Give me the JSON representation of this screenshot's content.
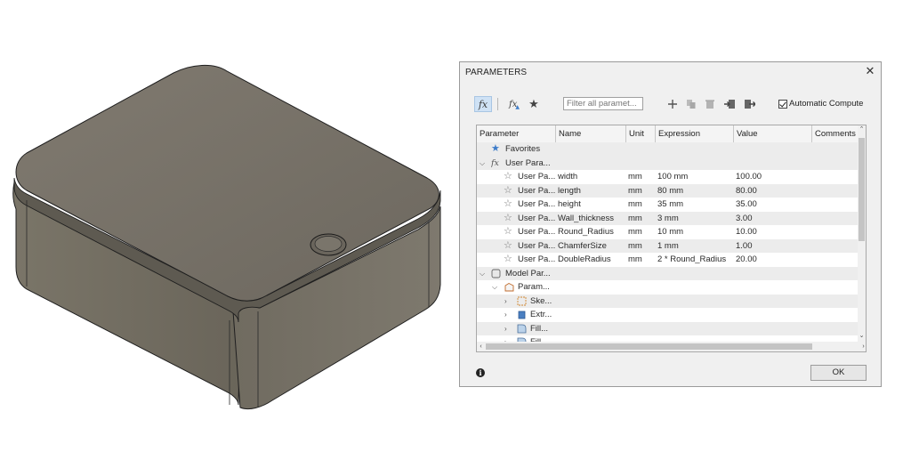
{
  "dialog": {
    "title": "PARAMETERS",
    "close_glyph": "✕",
    "toolbar": {
      "fx_label": "fx",
      "fx_filter_label": "fx",
      "favorites_glyph": "★",
      "filter_placeholder": "Filter all paramet...",
      "auto_compute_label": "Automatic Compute",
      "auto_compute_checked": true
    },
    "table": {
      "columns": [
        "Parameter",
        "Name",
        "Unit",
        "Expression",
        "Value",
        "Comments"
      ],
      "favorites_label": "Favorites",
      "user_params_group": "User Para...",
      "user_params": [
        {
          "parameter": "User Pa...",
          "name": "width",
          "unit": "mm",
          "expression": "100 mm",
          "value": "100.00"
        },
        {
          "parameter": "User Pa...",
          "name": "length",
          "unit": "mm",
          "expression": "80 mm",
          "value": "80.00"
        },
        {
          "parameter": "User Pa...",
          "name": "height",
          "unit": "mm",
          "expression": "35 mm",
          "value": "35.00"
        },
        {
          "parameter": "User Pa...",
          "name": "Wall_thickness",
          "unit": "mm",
          "expression": "3 mm",
          "value": "3.00"
        },
        {
          "parameter": "User Pa...",
          "name": "Round_Radius",
          "unit": "mm",
          "expression": "10 mm",
          "value": "10.00"
        },
        {
          "parameter": "User Pa...",
          "name": "ChamferSize",
          "unit": "mm",
          "expression": "1 mm",
          "value": "1.00"
        },
        {
          "parameter": "User Pa...",
          "name": "DoubleRadius",
          "unit": "mm",
          "expression": "2 * Round_Radius",
          "value": "20.00"
        }
      ],
      "model_params_group": "Model Par...",
      "model_sub_group": "Param...",
      "model_items": [
        "Ske...",
        "Extr...",
        "Fill...",
        "Fill..."
      ]
    },
    "ok_label": "OK",
    "info_glyph": "i"
  },
  "colors": {
    "box_body": "#6e6a5e",
    "box_top": "#77726a",
    "favorites_star": "#3d7cc9",
    "dialog_bg": "#f0f0f0"
  }
}
